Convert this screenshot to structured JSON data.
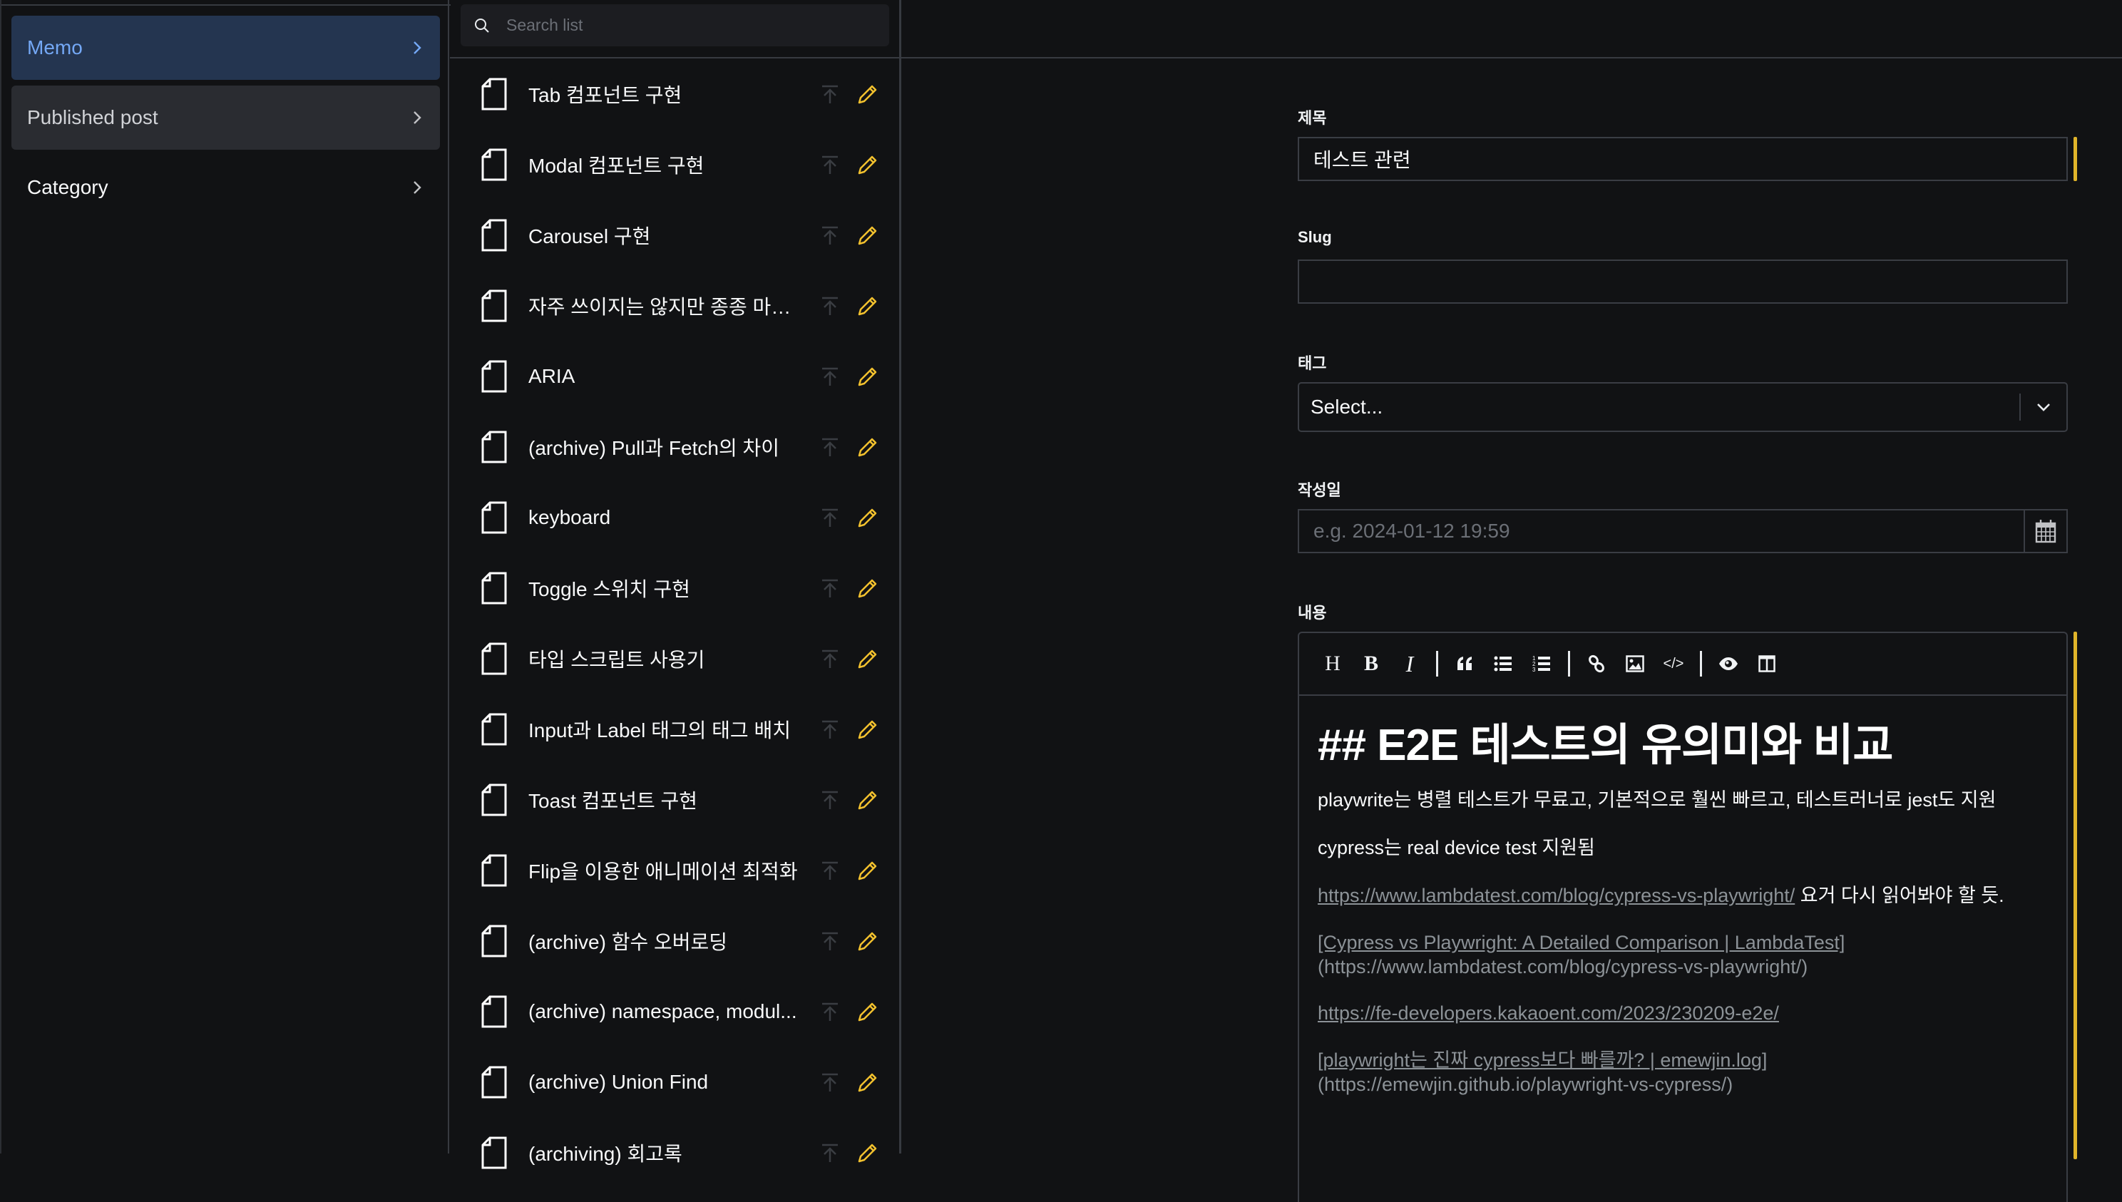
{
  "nav": {
    "items": [
      {
        "label": "Memo",
        "state": "active"
      },
      {
        "label": "Published post",
        "state": "hover"
      },
      {
        "label": "Category",
        "state": "plain"
      }
    ]
  },
  "list": {
    "search_placeholder": "Search list",
    "items": [
      {
        "title": "Tab 컴포넌트 구현"
      },
      {
        "title": "Modal 컴포넌트 구현"
      },
      {
        "title": "Carousel 구현"
      },
      {
        "title": "자주 쓰이지는 않지만 종종 마주..."
      },
      {
        "title": "ARIA"
      },
      {
        "title": "(archive) Pull과 Fetch의 차이"
      },
      {
        "title": "keyboard"
      },
      {
        "title": "Toggle 스위치 구현"
      },
      {
        "title": "타입 스크립트 사용기"
      },
      {
        "title": "Input과 Label 태그의 태그 배치"
      },
      {
        "title": "Toast 컴포넌트 구현"
      },
      {
        "title": "Flip을 이용한 애니메이션 최적화"
      },
      {
        "title": "(archive) 함수 오버로딩"
      },
      {
        "title": "(archive) namespace, modul..."
      },
      {
        "title": "(archive) Union Find"
      },
      {
        "title": "(archiving) 회고록"
      }
    ]
  },
  "form": {
    "title_label": "제목",
    "title_value": "테스트 관련",
    "slug_label": "Slug",
    "slug_value": "",
    "tag_label": "태그",
    "tag_value": "Select...",
    "date_label": "작성일",
    "date_placeholder": "e.g. 2024-01-12 19:59",
    "content_label": "내용"
  },
  "editor": {
    "toolbar": [
      {
        "name": "heading",
        "glyph": "H"
      },
      {
        "name": "bold",
        "glyph": "B"
      },
      {
        "name": "italic",
        "glyph": "I"
      },
      {
        "name": "quote",
        "glyph": "❝"
      },
      {
        "name": "unordered-list",
        "glyph": ""
      },
      {
        "name": "ordered-list",
        "glyph": ""
      },
      {
        "name": "link",
        "glyph": ""
      },
      {
        "name": "image",
        "glyph": ""
      },
      {
        "name": "code",
        "glyph": "</>"
      },
      {
        "name": "preview",
        "glyph": ""
      },
      {
        "name": "side-by-side",
        "glyph": ""
      }
    ],
    "heading": "## E2E 테스트의 유의미와 비교",
    "p1": "playwrite는 병렬 테스트가 무료고, 기본적으로 훨씬 빠르고, 테스트러너로 jest도 지원",
    "p2": "cypress는 real device test 지원됨",
    "p3_link": "https://www.lambdatest.com/blog/cypress-vs-playwright/",
    "p3_text": " 요거 다시 읽어봐야 할 듯.",
    "p4_link": "[Cypress vs Playwright: A Detailed Comparison | LambdaTest]",
    "p4_url": "(https://www.lambdatest.com/blog/cypress-vs-playwright/)",
    "p5_link": "https://fe-developers.kakaoent.com/2023/230209-e2e/",
    "p6_link": "[playwright는 진짜 cypress보다 빠를까? | emewjin.log]",
    "p6_url": "(https://emewjin.github.io/playwright-vs-cypress/)"
  },
  "colors": {
    "accent_yellow": "#e0b42a",
    "active_nav_bg": "#243550",
    "active_nav_text": "#74a8f5",
    "edit_icon": "#f2c12e"
  }
}
